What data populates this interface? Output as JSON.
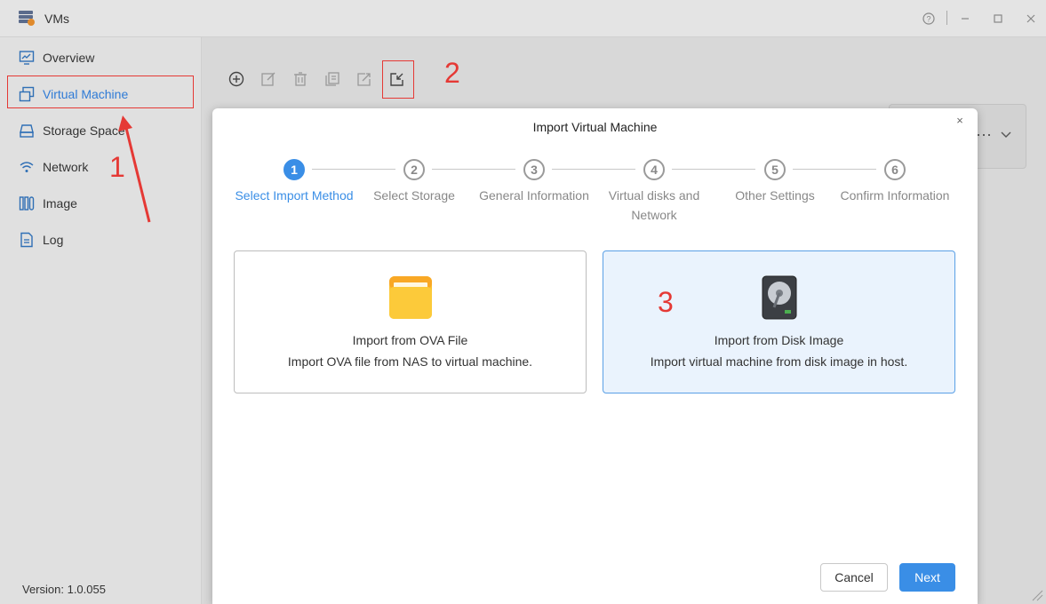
{
  "window": {
    "title": "VMs"
  },
  "sidebar": {
    "items": [
      {
        "label": "Overview",
        "icon": "monitor-icon"
      },
      {
        "label": "Virtual Machine",
        "icon": "vm-copy-icon",
        "active": true
      },
      {
        "label": "Storage Space",
        "icon": "storage-icon"
      },
      {
        "label": "Network",
        "icon": "wifi-icon"
      },
      {
        "label": "Image",
        "icon": "image-stack-icon"
      },
      {
        "label": "Log",
        "icon": "log-icon"
      }
    ],
    "version": "Version: 1.0.055"
  },
  "annotations": {
    "one": "1",
    "two": "2",
    "three": "3"
  },
  "modal": {
    "title": "Import Virtual Machine",
    "close": "×",
    "steps": [
      {
        "num": "1",
        "label": "Select Import Method",
        "active": true
      },
      {
        "num": "2",
        "label": "Select Storage"
      },
      {
        "num": "3",
        "label": "General Information"
      },
      {
        "num": "4",
        "label": "Virtual disks and Network"
      },
      {
        "num": "5",
        "label": "Other Settings"
      },
      {
        "num": "6",
        "label": "Confirm Information"
      }
    ],
    "options": [
      {
        "title": "Import from OVA File",
        "desc": "Import OVA file from NAS to virtual machine.",
        "icon": "folder-icon"
      },
      {
        "title": "Import from Disk Image",
        "desc": "Import virtual machine from disk image in host.",
        "icon": "hard-disk-icon",
        "selected": true
      }
    ],
    "cancel": "Cancel",
    "next": "Next"
  },
  "colors": {
    "accent": "#3a8ee6",
    "annotation": "#e53935"
  }
}
